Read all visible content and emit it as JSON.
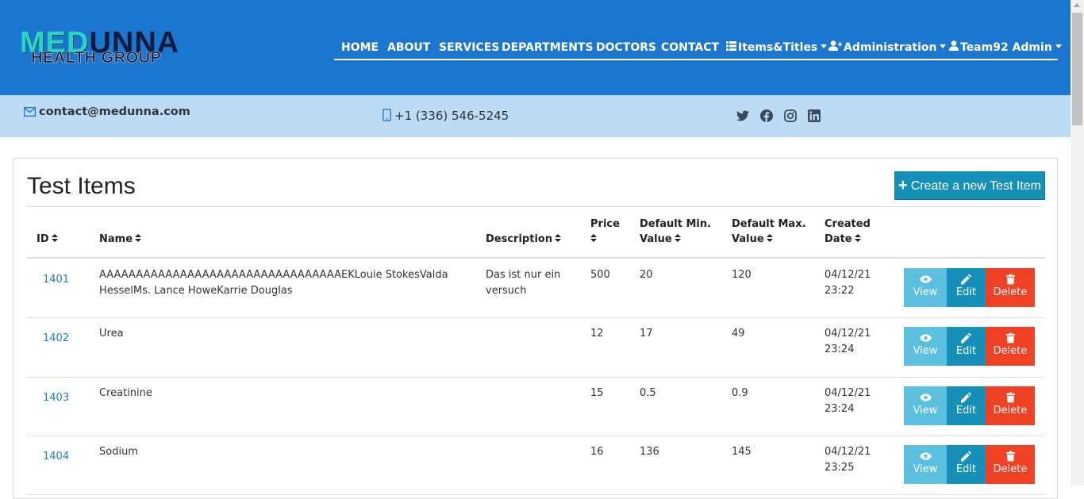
{
  "brand": {
    "logo_top_a": "MED",
    "logo_top_b": "UNNA",
    "logo_bottom": "HEALTH GROUP"
  },
  "nav": {
    "home": "HOME",
    "about": "ABOUT",
    "services": "SERVICES",
    "departments": "DEPARTMENTS",
    "doctors": "DOCTORS",
    "contact": "CONTACT",
    "items_titles": "Items&Titles",
    "administration": "Administration",
    "account": "Team92 Admin"
  },
  "contact": {
    "email": "contact@medunna.com",
    "phone": "+1 (336) 546-5245"
  },
  "social": [
    "twitter-icon",
    "facebook-icon",
    "instagram-icon",
    "linkedin-icon"
  ],
  "page": {
    "title": "Test Items",
    "create_label": "Create a new Test Item"
  },
  "table": {
    "headers": {
      "id": "ID",
      "name": "Name",
      "description": "Description",
      "price": "Price",
      "min_line1": "Default Min.",
      "min_line2": "Value",
      "max_line1": "Default Max.",
      "max_line2": "Value",
      "created_line1": "Created",
      "created_line2": "Date"
    },
    "rows": [
      {
        "id": "1401",
        "name": "AAAAAAAAAAAAAAAAAAAAAAAAAAAAAAAAAEKLouie StokesValda HesselMs. Lance HoweKarrie Douglas",
        "description": "Das ist nur ein versuch",
        "price": "500",
        "min": "20",
        "max": "120",
        "date": "04/12/21",
        "time": "23:22"
      },
      {
        "id": "1402",
        "name": "Urea",
        "description": "",
        "price": "12",
        "min": "17",
        "max": "49",
        "date": "04/12/21",
        "time": "23:24"
      },
      {
        "id": "1403",
        "name": "Creatinine",
        "description": "",
        "price": "15",
        "min": "0.5",
        "max": "0.9",
        "date": "04/12/21",
        "time": "23:24"
      },
      {
        "id": "1404",
        "name": "Sodium",
        "description": "",
        "price": "16",
        "min": "136",
        "max": "145",
        "date": "04/12/21",
        "time": "23:25"
      }
    ],
    "actions": {
      "view": "View",
      "edit": "Edit",
      "delete": "Delete"
    }
  },
  "colors": {
    "header": "#1b76d0",
    "contact_bar": "#bcdcf5",
    "view": "#5bc0de",
    "edit": "#1590b8",
    "delete": "#f04124",
    "link": "#1b7fbd"
  }
}
